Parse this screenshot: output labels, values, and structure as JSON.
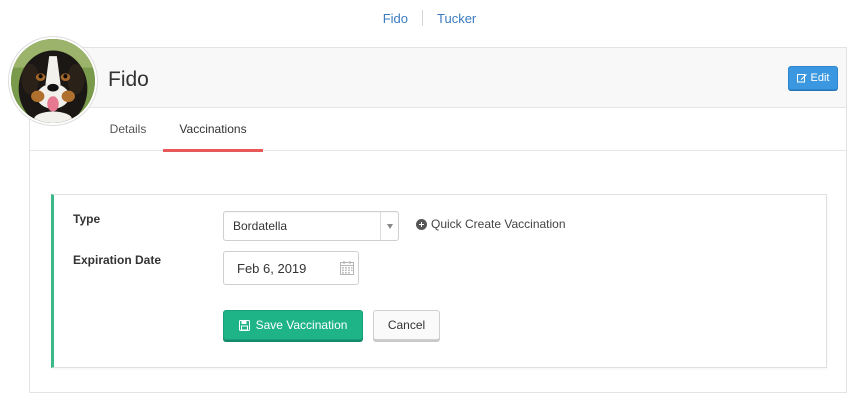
{
  "top_nav": {
    "links": [
      "Fido",
      "Tucker"
    ]
  },
  "pet": {
    "name": "Fido",
    "avatar_icon": "dog-photo"
  },
  "header": {
    "edit_label": "Edit",
    "edit_icon": "edit-icon"
  },
  "tabs": [
    {
      "label": "Details",
      "active": false
    },
    {
      "label": "Vaccinations",
      "active": true
    }
  ],
  "form": {
    "type_label": "Type",
    "type_value": "Bordatella",
    "quick_create_label": "Quick Create Vaccination",
    "expiration_label": "Expiration Date",
    "expiration_value": "Feb 6, 2019",
    "save_label": "Save Vaccination",
    "cancel_label": "Cancel"
  },
  "colors": {
    "accent_blue": "#3a97e0",
    "save_green": "#1fb388",
    "tab_active_underline": "#e85858",
    "panel_left_border": "#3bb98a",
    "link_blue": "#3b7bbf"
  }
}
